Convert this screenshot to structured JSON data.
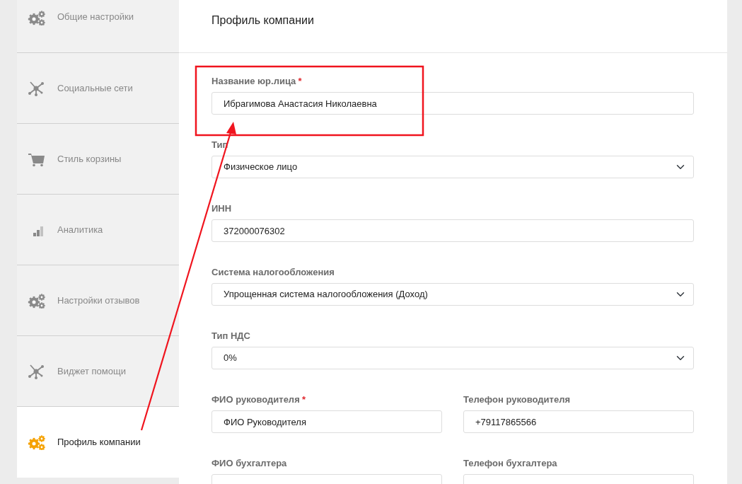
{
  "sidebar": {
    "items": [
      {
        "label": "Общие настройки",
        "kind": "gears",
        "selected": false
      },
      {
        "label": "Социальные сети",
        "kind": "network",
        "selected": false
      },
      {
        "label": "Стиль корзины",
        "kind": "cart",
        "selected": false
      },
      {
        "label": "Аналитика",
        "kind": "bars",
        "selected": false
      },
      {
        "label": "Настройки отзывов",
        "kind": "gears",
        "selected": false
      },
      {
        "label": "Виджет помощи",
        "kind": "network",
        "selected": false
      },
      {
        "label": "Профиль компании",
        "kind": "gears",
        "selected": true
      }
    ]
  },
  "page": {
    "title": "Профиль компании"
  },
  "form": {
    "rows": [
      {
        "fields": [
          {
            "label": "Название юр.лица",
            "required_mark": "*",
            "kind": "input",
            "value": "Ибрагимова Анастасия Николаевна"
          }
        ]
      },
      {
        "fields": [
          {
            "label": "Тип",
            "kind": "select",
            "value": "Физическое лицо"
          }
        ]
      },
      {
        "fields": [
          {
            "label": "ИНН",
            "kind": "input",
            "value": "372000076302"
          }
        ]
      },
      {
        "fields": [
          {
            "label": "Система налогообложения",
            "kind": "select",
            "value": "Упрощенная система налогообложения (Доход)"
          }
        ]
      },
      {
        "fields": [
          {
            "label": "Тип НДС",
            "kind": "select",
            "value": "0%"
          }
        ]
      },
      {
        "fields": [
          {
            "label": "ФИО руководителя",
            "required_mark": "*",
            "kind": "input",
            "value": "ФИО Руководителя"
          },
          {
            "label": "Телефон руководителя",
            "kind": "input",
            "value": "+79117865566"
          }
        ]
      },
      {
        "fields": [
          {
            "label": "ФИО бухгалтера",
            "kind": "input"
          },
          {
            "label": "Телефон бухгалтера",
            "kind": "input"
          }
        ]
      }
    ]
  }
}
